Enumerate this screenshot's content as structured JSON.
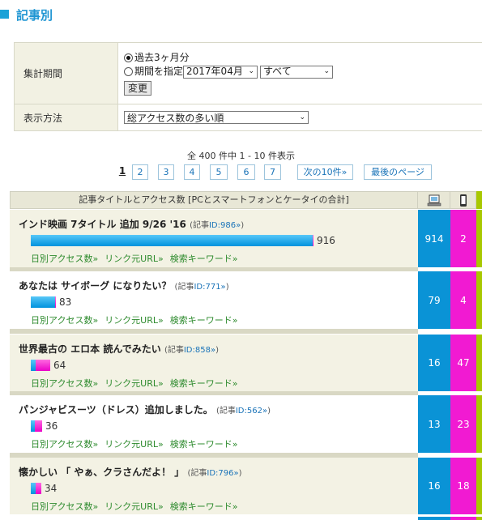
{
  "header": {
    "title": "記事別"
  },
  "settings": {
    "period_label": "集計期間",
    "radio_recent": "過去3ヶ月分",
    "radio_specify": "期間を指定",
    "month_select": "2017年04月",
    "scope_select": "すべて",
    "change_button": "変更",
    "display_label": "表示方法",
    "order_select": "総アクセス数の多い順"
  },
  "summary": "全 400 件中 1 - 10 件表示",
  "pager": {
    "current": "1",
    "pages": [
      "2",
      "3",
      "4",
      "5",
      "6",
      "7"
    ],
    "next": "次の10件»",
    "last": "最後のページ"
  },
  "table": {
    "header_title": "記事タイトルとアクセス数 [PCとスマートフォンとケータイの合計]",
    "pc_icon": "computer-icon",
    "sp_icon": "smartphone-icon"
  },
  "links": {
    "daily": "日別アクセス数»",
    "referrer": "リンク元URL»",
    "keyword": "検索キーワード»"
  },
  "articles": [
    {
      "title": "インド映画 7タイトル 追加 9/26 '16",
      "id_prefix": "(記事",
      "id_text": "ID:986»",
      "id_suffix": ")",
      "total": 916,
      "pc": 914,
      "sp": 2
    },
    {
      "title": "あなたは サイボーグ になりたい？",
      "id_prefix": "(記事",
      "id_text": "ID:771»",
      "id_suffix": ")",
      "total": 83,
      "pc": 79,
      "sp": 4
    },
    {
      "title": "世界最古の エロ本 読んでみたい",
      "id_prefix": "(記事",
      "id_text": "ID:858»",
      "id_suffix": ")",
      "total": 64,
      "pc": 16,
      "sp": 47
    },
    {
      "title": "パンジャビスーツ（ドレス）追加しました。",
      "id_prefix": "(記事",
      "id_text": "ID:562»",
      "id_suffix": ")",
      "total": 36,
      "pc": 13,
      "sp": 23
    },
    {
      "title": "懐かしい 「 やぁ、クラさんだよ！ 」",
      "id_prefix": "(記事",
      "id_text": "ID:796»",
      "id_suffix": ")",
      "total": 34,
      "pc": 16,
      "sp": 18
    }
  ],
  "colors": {
    "accent": "#2196d3",
    "pc": "#0a93d6",
    "sp": "#f11ad2",
    "mobile": "#a8c800"
  }
}
